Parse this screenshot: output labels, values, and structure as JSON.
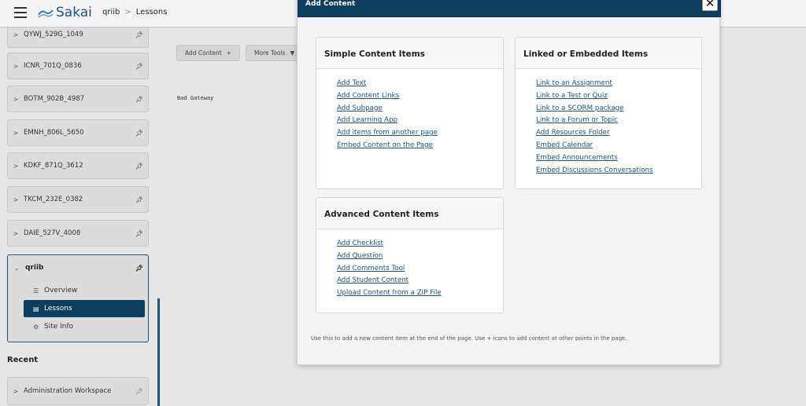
{
  "header": {
    "logo_text": "Sakai",
    "breadcrumb": [
      "qriib",
      "Lessons"
    ],
    "breadcrumb_sep": ">"
  },
  "sidebar": {
    "sites": [
      {
        "label": "QYWJ_529G_1049",
        "icon": "pin-icon"
      },
      {
        "label": "ICNR_701Q_0836",
        "icon": "pin-icon"
      },
      {
        "label": "BOTM_902B_4987",
        "icon": "pin-icon"
      },
      {
        "label": "EMNH_806L_5650",
        "icon": "pin-icon"
      },
      {
        "label": "KDKF_871Q_3612",
        "icon": "pin-icon"
      },
      {
        "label": "TKCM_232E_0382",
        "icon": "pin-icon"
      },
      {
        "label": "DAIE_527V_4008",
        "icon": "pin-icon"
      }
    ],
    "open_site": {
      "label": "qriib",
      "tools": [
        {
          "label": "Overview",
          "icon": "list-icon"
        },
        {
          "label": "Lessons",
          "icon": "document-icon",
          "active": true
        },
        {
          "label": "Site Info",
          "icon": "gear-icon"
        }
      ]
    },
    "recent_heading": "Recent",
    "recent": [
      {
        "label": "Administration Workspace",
        "icon": "pin-icon"
      }
    ]
  },
  "main": {
    "add_content_button": "Add Content",
    "add_content_glyph": "+",
    "more_tools_button": "More Tools",
    "error_text": "Bad Gateway"
  },
  "modal": {
    "title": "Add Content",
    "close_glyph": "✕",
    "simple": {
      "heading": "Simple Content Items",
      "items": [
        "Add Text",
        "Add Content Links",
        "Add Subpage",
        "Add Learning App",
        "Add items from another page",
        "Embed Content on the Page"
      ]
    },
    "linked": {
      "heading": "Linked or Embedded Items",
      "items": [
        "Link to an Assignment",
        "Link to a Test or Quiz",
        "Link to a SCORM package",
        "Link to a Forum or Topic",
        "Add Resources Folder",
        "Embed Calendar",
        "Embed Announcements",
        "Embed Discussions Conversations"
      ]
    },
    "advanced": {
      "heading": "Advanced Content Items",
      "items": [
        "Add Checklist",
        "Add Question",
        "Add Comments Tool",
        "Add Student Content",
        "Upload Content from a ZIP File"
      ]
    },
    "hint": "Use this to add a new content item at the end of the page. Use + icons to add content at other points in the page."
  },
  "colors": {
    "brand": "#0f3d5e",
    "link": "#23527c",
    "background": "#e6e6e6"
  }
}
